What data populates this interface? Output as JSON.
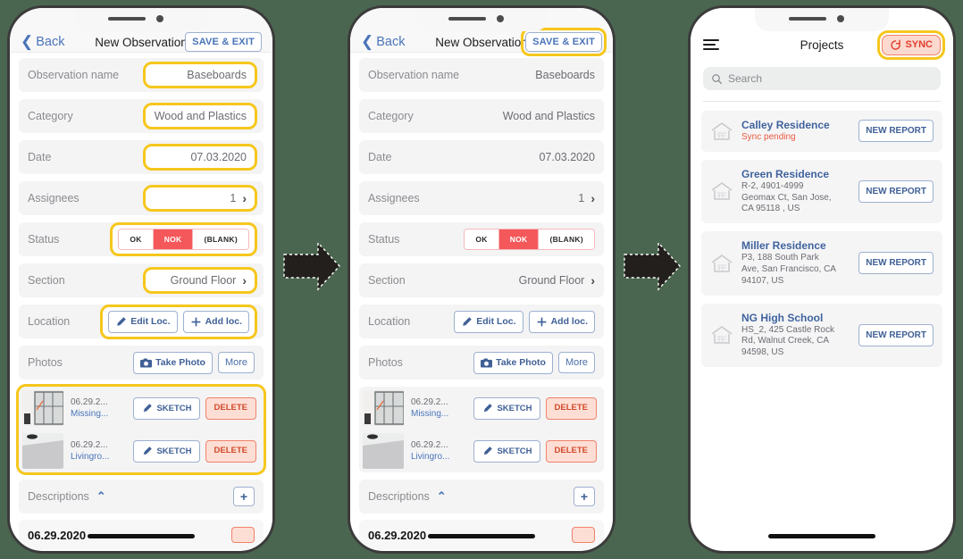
{
  "observation": {
    "header": {
      "back_label": "Back",
      "title": "New Observation",
      "save_exit_label": "SAVE & EXIT"
    },
    "rows": [
      {
        "label": "Observation name",
        "value": "Baseboards"
      },
      {
        "label": "Category",
        "value": "Wood and Plastics"
      },
      {
        "label": "Date",
        "value": "07.03.2020"
      },
      {
        "label": "Assignees",
        "value": "1",
        "chevron": "›"
      },
      {
        "label": "Section",
        "value": "Ground Floor",
        "chevron": "›"
      }
    ],
    "status": {
      "label": "Status",
      "options": [
        "OK",
        "NOK",
        "(BLANK)"
      ],
      "selected": "NOK"
    },
    "location": {
      "label": "Location",
      "edit_label": "Edit Loc.",
      "add_label": "Add loc."
    },
    "photos": {
      "label": "Photos",
      "take_photo_label": "Take Photo",
      "more_label": "More",
      "items": [
        {
          "date": "06.29.2...",
          "name": "Missing...",
          "sketch_label": "SKETCH",
          "delete_label": "DELETE"
        },
        {
          "date": "06.29.2...",
          "name": "Livingro...",
          "sketch_label": "SKETCH",
          "delete_label": "DELETE"
        }
      ]
    },
    "descriptions": {
      "label": "Descriptions",
      "collapse_caret": "⌃",
      "add_label": "+"
    },
    "cut_row": {
      "text": "06.29.2020"
    },
    "highlight_color": "#f6c71d"
  },
  "projects": {
    "header": {
      "title": "Projects",
      "sync_label": "SYNC"
    },
    "search": {
      "placeholder": "Search",
      "value": ""
    },
    "items": [
      {
        "name": "Calley Residence",
        "sub": "Sync pending",
        "sync_pending": true,
        "action_label": "NEW REPORT"
      },
      {
        "name": "Green Residence",
        "sub": "R-2, 4901-4999\nGeomax Ct, San Jose,\nCA 95118 , US",
        "sync_pending": false,
        "action_label": "NEW REPORT"
      },
      {
        "name": "Miller Residence",
        "sub": "P3, 188 South Park\nAve, San Francisco, CA\n94107, US",
        "sync_pending": false,
        "action_label": "NEW REPORT"
      },
      {
        "name": "NG High School",
        "sub": "HS_2, 425 Castle Rock\nRd, Walnut Creek, CA\n94598, US",
        "sync_pending": false,
        "action_label": "NEW REPORT"
      }
    ]
  },
  "colors": {
    "background": "#4b6650",
    "highlight": "#f6c71d",
    "accent_blue": "#3f6096",
    "status_red": "#f4585b",
    "sync_red": "#e23c2c"
  }
}
